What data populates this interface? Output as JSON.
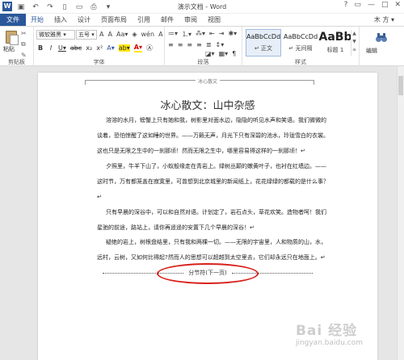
{
  "titlebar": {
    "logo": "W",
    "title": "演示文档 - Word",
    "qat": [
      "save-icon",
      "undo-icon",
      "redo-icon",
      "new-doc-icon",
      "open-icon",
      "print-icon",
      "more-icon"
    ],
    "controls": [
      "?",
      "▭",
      "—",
      "□",
      "✕"
    ]
  },
  "tabs": {
    "file": "文件",
    "items": [
      "开始",
      "插入",
      "设计",
      "页面布局",
      "引用",
      "邮件",
      "审阅",
      "视图"
    ],
    "user": "木 方 ▾"
  },
  "ribbon": {
    "clipboard": {
      "paste": "粘贴",
      "label": "剪贴板"
    },
    "font": {
      "name": "微软雅黑 ▾",
      "size": "五号 ▾",
      "misc": [
        "A",
        "A",
        "Aa▾",
        "◈",
        "wén",
        "A"
      ],
      "row2": [
        "B",
        "I",
        "U▾",
        "abc",
        "x₂",
        "x²",
        "A▾",
        "ab▾",
        "A▾",
        "Ⓐ"
      ],
      "label": "字体"
    },
    "paragraph": {
      "row1": [
        "≔▾",
        "⒈▾",
        "⁂▾",
        "⇤",
        "⇥",
        "✱▾"
      ],
      "row2": [
        "≡",
        "≡",
        "≡",
        "≡",
        "≣",
        "↕▾"
      ],
      "row3": [
        "◪▾",
        "▦▾",
        "¶"
      ],
      "label": "段落"
    },
    "styles": {
      "items": [
        {
          "sample": "AaBbCcDd",
          "name": "↵ 正文"
        },
        {
          "sample": "AaBbCcDd",
          "name": "↵ 无间隔"
        },
        {
          "sample": "AaBb",
          "name": "标题 1"
        }
      ],
      "label": "样式"
    },
    "editing": {
      "label": "编辑"
    }
  },
  "document": {
    "header": "冰心散文",
    "title": "冰心散文：山中杂感",
    "paragraphs": [
      "溶溶的水月，螃蟹上只有她和我，树影里对面水边，隐隐的听见水声和笑语。我们微微的谈着，恐怕惊醒了这如睡的世界。——万籁无声，月光下只有深碧的池水，玲珑雪白的衣裳。这也只是无限之生中的一刹那顷！然而无限之生中，哪里容易得这样的一刹那顷！↵",
      "夕照里，牛羊下山了，小蚁般缘走在青岩上。绿树丛颠的嫩黄叶子，也衬在红墙边。——这时节，万有都笼盖在寂寞里，可曾想到北京城里的新闻纸上，花花绿绿的都载的是什么事？↵",
      "只有早晨的深谷中，可以和自然对语。计划定了，岩石点头，草花欢笑。造物者呵！我们星驰的前途，路站上，请你再遥遥的安置下几个早晨的深谷！↵",
      "疑绝的岩上，树根盘结里，只有我和两棵一切。——无限的宇宙里，人和物质的山，水，远村，云树，又如何比得起?然而人的思想可以超越到太空里去，它们却永远只在地面上。↵"
    ],
    "section_break": "分节符(下一页)"
  },
  "watermark": {
    "main": "Bai 经验",
    "sub": "jingyan.baidu.com"
  }
}
